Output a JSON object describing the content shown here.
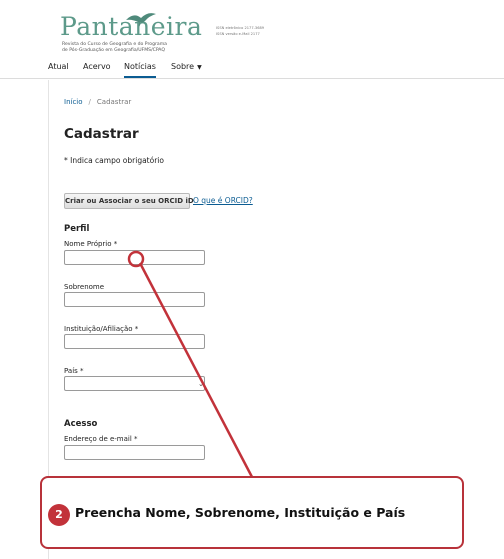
{
  "header": {
    "logo_word": "Pantaneira",
    "logo_sub_line1": "Revista do Curso de Geografia e do Programa",
    "logo_sub_line2": "de Pós-Graduação em Geografia/UFMS/CPAQ",
    "issn_1": "ISSN eletrônico 2177-3689",
    "issn_2": "ISSN versão e-Mail 2177"
  },
  "nav": {
    "items": [
      {
        "label": "Atual"
      },
      {
        "label": "Acervo"
      },
      {
        "label": "Notícias"
      },
      {
        "label": "Sobre"
      }
    ],
    "active_index": 2,
    "caret": "▼"
  },
  "breadcrumb": {
    "home": "Início",
    "separator": "/",
    "current": "Cadastrar"
  },
  "page": {
    "title": "Cadastrar",
    "required_note": "* Indica campo obrigatório"
  },
  "orcid": {
    "button_label": "Criar ou Associar o seu ORCID iD",
    "link_label": "O que é ORCID?"
  },
  "form": {
    "profile_section": "Perfil",
    "given_name_label": "Nome Próprio *",
    "family_name_label": "Sobrenome",
    "affiliation_label": "Instituição/Afiliação *",
    "country_label": "País *",
    "access_section": "Acesso",
    "email_label": "Endereço de e-mail *"
  },
  "annotation": {
    "step_number": "2",
    "instruction": "Preencha Nome, Sobrenome, Instituição e País"
  },
  "colors": {
    "brand": "#5d9a8a",
    "link": "#0b5c92",
    "annotation_red": "#c2323a"
  }
}
